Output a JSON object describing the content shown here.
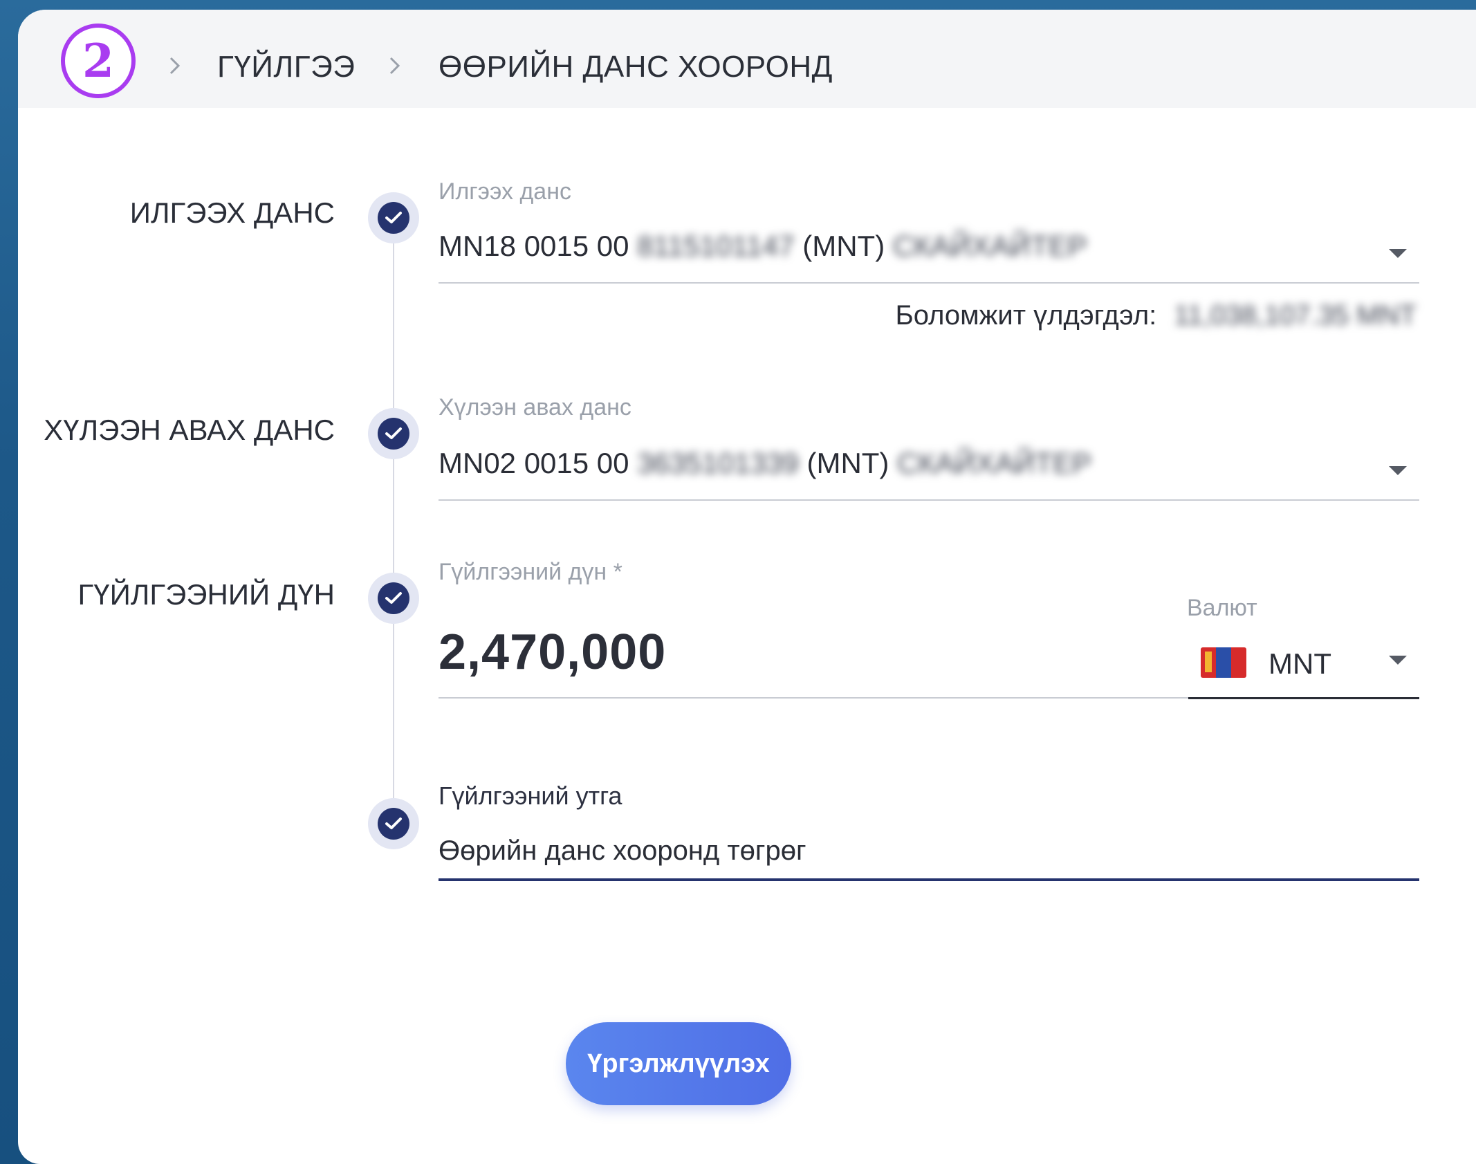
{
  "breadcrumb": {
    "step_number": "2",
    "items": [
      "ГҮЙЛГЭЭ",
      "ӨӨРИЙН ДАНС ХООРОНД"
    ]
  },
  "steps": {
    "from_label": "ИЛГЭЭХ ДАНС",
    "to_label": "ХҮЛЭЭН АВАХ ДАНС",
    "amount_label": "ГҮЙЛГЭЭНИЙ ДҮН"
  },
  "from_account": {
    "caption": "Илгээх данс",
    "prefix": "MN18 0015 00",
    "masked_number": "8115101147",
    "currency": "(MNT)",
    "masked_holder": "СКАЙХАЙТЕР",
    "balance_label": "Боломжит үлдэгдэл:",
    "masked_balance": "11,038,107.35 MNT"
  },
  "to_account": {
    "caption": "Хүлээн авах данс",
    "prefix": "MN02 0015 00",
    "masked_number": "3635101339",
    "currency": "(MNT)",
    "masked_holder": "СКАЙХАЙТЕР"
  },
  "amount": {
    "caption": "Гүйлгээний дүн *",
    "value": "2,470,000",
    "currency_caption": "Валют",
    "currency": "MNT"
  },
  "purpose": {
    "caption": "Гүйлгээний утга",
    "value": "Өөрийн данс хооронд төгрөг"
  },
  "continue_label": "Үргэлжлүүлэх",
  "colors": {
    "accent": "#25336e",
    "button": "#5a7ff0",
    "badge": "#a93cf0",
    "flag_red": "#d62b2b",
    "flag_blue": "#2a4fa8",
    "flag_gold": "#f2b430"
  }
}
